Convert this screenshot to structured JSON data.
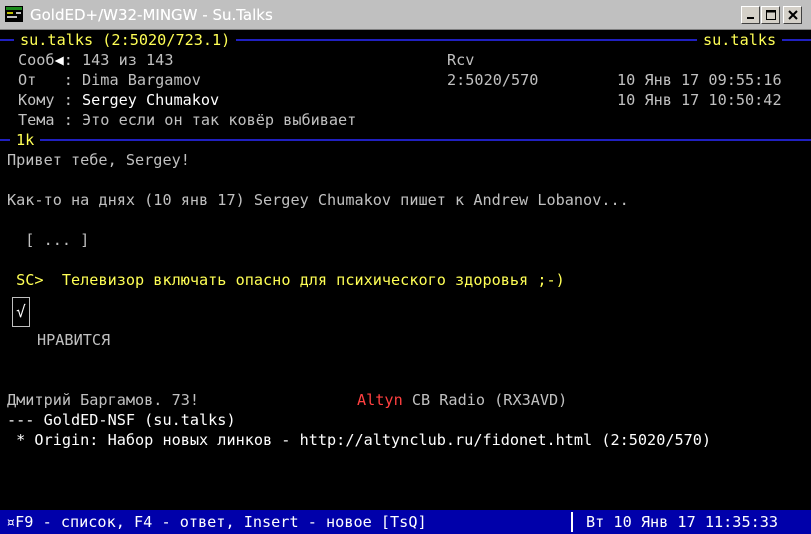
{
  "window": {
    "title": "GoldED+/W32-MINGW - Su.Talks",
    "icon": "golded-app-icon",
    "controls": {
      "minimize": "minimize-icon",
      "maximize": "maximize-icon",
      "close": "close-icon"
    }
  },
  "header": {
    "area": "su.talks (2:5020/723.1)",
    "area_right": "su.talks",
    "msg_label": "Сооб",
    "msg_counter": ": 143 из 143",
    "flag": "Rcv",
    "from_label": "От   : ",
    "from_name": "Dima Bargamov",
    "from_addr": "2:5020/570",
    "from_date": "10 Янв 17 09:55:16",
    "to_label": "Кому : ",
    "to_name": "Sergey Chumakov",
    "to_date": "10 Янв 17 10:50:42",
    "subject_label": "Тема : ",
    "subject": "Это если он так ковёр выбивает",
    "size": "1k"
  },
  "body": {
    "greeting": "Привет тебе, Sergey!",
    "intro": "Как-то на днях (10 янв 17) Sergey Chumakov пишет к Andrew Lobanov...",
    "snip": "  [ ... ]",
    "quote_prefix": " SC>",
    "quote_text": "  Телевизор включать опасно для психического здоровья ;-)",
    "like_mark": "√",
    "like_text": "НРАВИТСЯ",
    "signature_name": "Дмитрий Баргамов. 73!",
    "signature_altyn": "Altyn",
    "signature_radio": " CB Radio (RX3AVD)",
    "tearline": "--- GoldED-NSF (su.talks)",
    "origin": " * Origin: Набор новых линков - http://altynclub.ru/fidonet.html (2:5020/570)"
  },
  "status": {
    "keys": "¤F9 - список, F4 - ответ, Insert - новое [TsQ]",
    "clock": "Вт 10 Янв 17 11:35:33"
  },
  "colors": {
    "background": "#000000",
    "text": "#c0c0c0",
    "highlight": "#ffffff",
    "quote": "#ffff55",
    "accent_red": "#ff4040",
    "rule_blue": "#2020c0",
    "status_bg": "#0000aa"
  }
}
